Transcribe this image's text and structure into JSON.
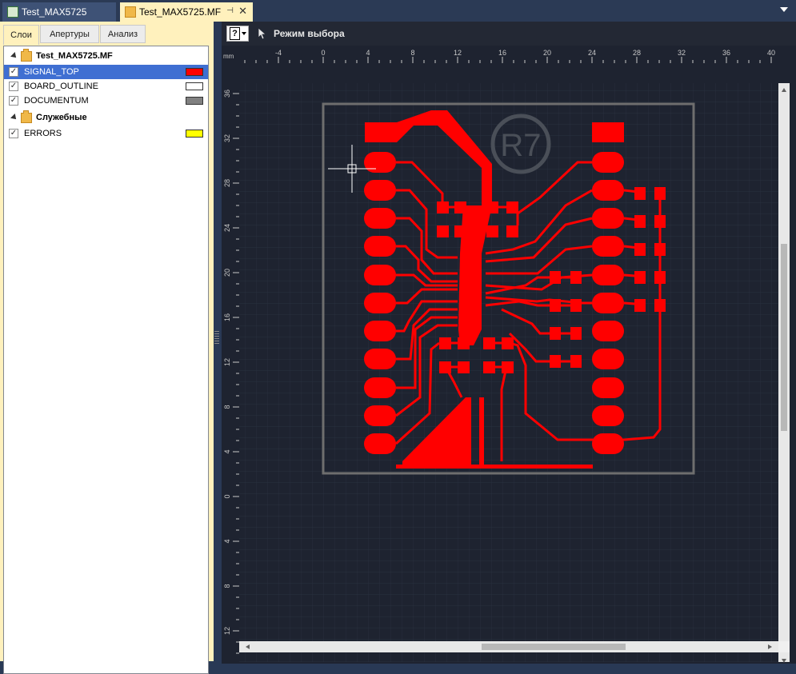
{
  "tabs": [
    {
      "label": "Test_MAX5725",
      "active": false
    },
    {
      "label": "Test_MAX5725.MF",
      "active": true
    }
  ],
  "left_panel": {
    "tabs": [
      "Слои",
      "Апертуры",
      "Анализ"
    ],
    "project_name": "Test_MAX5725.MF",
    "layers": [
      {
        "name": "SIGNAL_TOP",
        "color": "#ff0000",
        "checked": true
      },
      {
        "name": "BOARD_OUTLINE",
        "color": "#ffffff",
        "checked": true
      },
      {
        "name": "DOCUMENTUM",
        "color": "#808080",
        "checked": true
      }
    ],
    "service_group": "Служебные",
    "service_layers": [
      {
        "name": "ERRORS",
        "color": "#ffff00",
        "checked": true
      }
    ]
  },
  "toolbar": {
    "help_icon": "help-question-icon",
    "mode_label": "Режим выбора"
  },
  "rulers": {
    "unit": "mm",
    "x_labels": [
      "-4",
      "0",
      "4",
      "8",
      "12",
      "16",
      "20",
      "24",
      "28",
      "32",
      "36",
      "40"
    ],
    "y_labels": [
      "36",
      "32",
      "28",
      "24",
      "20",
      "16",
      "12",
      "8",
      "4",
      "0",
      "4",
      "8",
      "12",
      "16"
    ]
  },
  "board": {
    "logo": "R7",
    "signal_color": "#ff0000",
    "outline_color": "#808080",
    "background": "#1e2330"
  }
}
